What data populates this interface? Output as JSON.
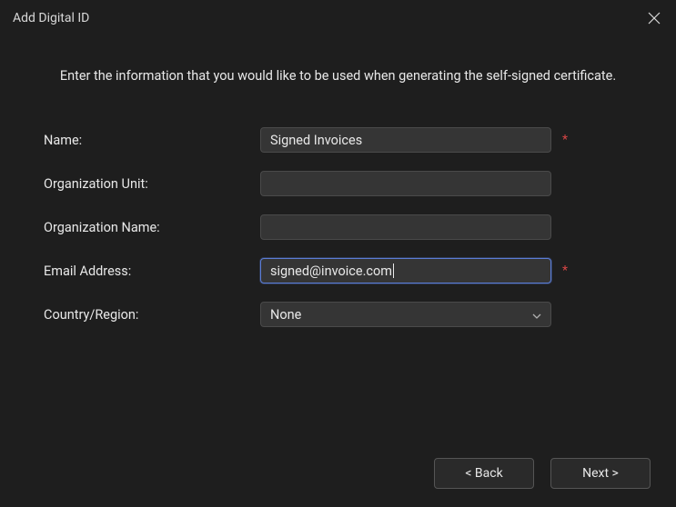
{
  "window": {
    "title": "Add Digital ID"
  },
  "instruction": "Enter the information that you would like to be used when generating the self-signed certificate.",
  "form": {
    "name": {
      "label": "Name:",
      "value": "Signed Invoices",
      "required": true
    },
    "orgUnit": {
      "label": "Organization Unit:",
      "value": "",
      "required": false
    },
    "orgName": {
      "label": "Organization Name:",
      "value": "",
      "required": false
    },
    "email": {
      "label": "Email Address:",
      "value": "signed@invoice.com",
      "required": true,
      "focused": true
    },
    "country": {
      "label": "Country/Region:",
      "selected": "None",
      "required": false
    }
  },
  "footer": {
    "back": "< Back",
    "next": "Next >"
  },
  "required_mark": "*"
}
